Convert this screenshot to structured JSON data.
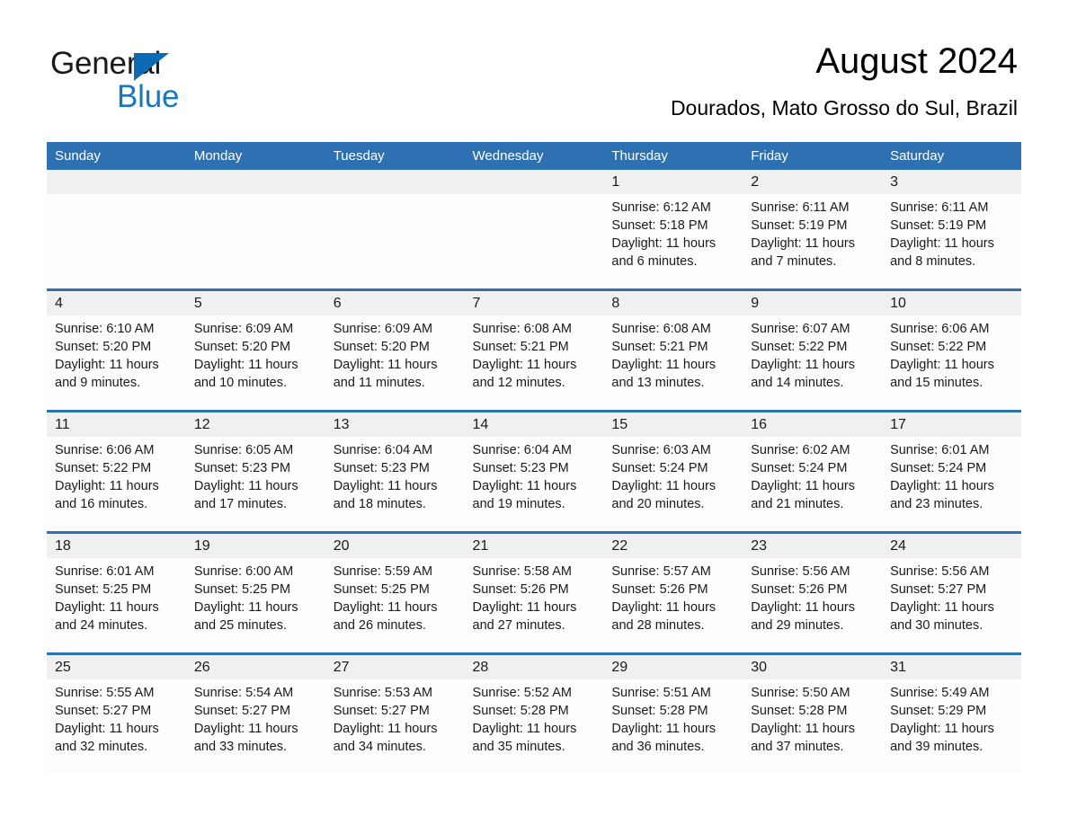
{
  "brand": {
    "name_part1": "General",
    "name_part2": "Blue",
    "triangle_color": "#0a6ab4",
    "blue_color": "#1878be"
  },
  "header": {
    "title": "August 2024",
    "subtitle": "Dourados, Mato Grosso do Sul, Brazil"
  },
  "theme": {
    "header_blue": "#2e71b3",
    "daynum_gray": "#f0f0f0",
    "cell_background": "#fdfdfd"
  },
  "calendar": {
    "weekday_headers": [
      "Sunday",
      "Monday",
      "Tuesday",
      "Wednesday",
      "Thursday",
      "Friday",
      "Saturday"
    ],
    "labels": {
      "sunrise_prefix": "Sunrise:",
      "sunset_prefix": "Sunset:",
      "daylight_prefix": "Daylight:"
    },
    "weeks": [
      [
        {
          "day": "",
          "empty": true
        },
        {
          "day": "",
          "empty": true
        },
        {
          "day": "",
          "empty": true
        },
        {
          "day": "",
          "empty": true
        },
        {
          "day": "1",
          "sunrise": "Sunrise: 6:12 AM",
          "sunset": "Sunset: 5:18 PM",
          "daylight": "Daylight: 11 hours and 6 minutes."
        },
        {
          "day": "2",
          "sunrise": "Sunrise: 6:11 AM",
          "sunset": "Sunset: 5:19 PM",
          "daylight": "Daylight: 11 hours and 7 minutes."
        },
        {
          "day": "3",
          "sunrise": "Sunrise: 6:11 AM",
          "sunset": "Sunset: 5:19 PM",
          "daylight": "Daylight: 11 hours and 8 minutes."
        }
      ],
      [
        {
          "day": "4",
          "sunrise": "Sunrise: 6:10 AM",
          "sunset": "Sunset: 5:20 PM",
          "daylight": "Daylight: 11 hours and 9 minutes."
        },
        {
          "day": "5",
          "sunrise": "Sunrise: 6:09 AM",
          "sunset": "Sunset: 5:20 PM",
          "daylight": "Daylight: 11 hours and 10 minutes."
        },
        {
          "day": "6",
          "sunrise": "Sunrise: 6:09 AM",
          "sunset": "Sunset: 5:20 PM",
          "daylight": "Daylight: 11 hours and 11 minutes."
        },
        {
          "day": "7",
          "sunrise": "Sunrise: 6:08 AM",
          "sunset": "Sunset: 5:21 PM",
          "daylight": "Daylight: 11 hours and 12 minutes."
        },
        {
          "day": "8",
          "sunrise": "Sunrise: 6:08 AM",
          "sunset": "Sunset: 5:21 PM",
          "daylight": "Daylight: 11 hours and 13 minutes."
        },
        {
          "day": "9",
          "sunrise": "Sunrise: 6:07 AM",
          "sunset": "Sunset: 5:22 PM",
          "daylight": "Daylight: 11 hours and 14 minutes."
        },
        {
          "day": "10",
          "sunrise": "Sunrise: 6:06 AM",
          "sunset": "Sunset: 5:22 PM",
          "daylight": "Daylight: 11 hours and 15 minutes."
        }
      ],
      [
        {
          "day": "11",
          "sunrise": "Sunrise: 6:06 AM",
          "sunset": "Sunset: 5:22 PM",
          "daylight": "Daylight: 11 hours and 16 minutes."
        },
        {
          "day": "12",
          "sunrise": "Sunrise: 6:05 AM",
          "sunset": "Sunset: 5:23 PM",
          "daylight": "Daylight: 11 hours and 17 minutes."
        },
        {
          "day": "13",
          "sunrise": "Sunrise: 6:04 AM",
          "sunset": "Sunset: 5:23 PM",
          "daylight": "Daylight: 11 hours and 18 minutes."
        },
        {
          "day": "14",
          "sunrise": "Sunrise: 6:04 AM",
          "sunset": "Sunset: 5:23 PM",
          "daylight": "Daylight: 11 hours and 19 minutes."
        },
        {
          "day": "15",
          "sunrise": "Sunrise: 6:03 AM",
          "sunset": "Sunset: 5:24 PM",
          "daylight": "Daylight: 11 hours and 20 minutes."
        },
        {
          "day": "16",
          "sunrise": "Sunrise: 6:02 AM",
          "sunset": "Sunset: 5:24 PM",
          "daylight": "Daylight: 11 hours and 21 minutes."
        },
        {
          "day": "17",
          "sunrise": "Sunrise: 6:01 AM",
          "sunset": "Sunset: 5:24 PM",
          "daylight": "Daylight: 11 hours and 23 minutes."
        }
      ],
      [
        {
          "day": "18",
          "sunrise": "Sunrise: 6:01 AM",
          "sunset": "Sunset: 5:25 PM",
          "daylight": "Daylight: 11 hours and 24 minutes."
        },
        {
          "day": "19",
          "sunrise": "Sunrise: 6:00 AM",
          "sunset": "Sunset: 5:25 PM",
          "daylight": "Daylight: 11 hours and 25 minutes."
        },
        {
          "day": "20",
          "sunrise": "Sunrise: 5:59 AM",
          "sunset": "Sunset: 5:25 PM",
          "daylight": "Daylight: 11 hours and 26 minutes."
        },
        {
          "day": "21",
          "sunrise": "Sunrise: 5:58 AM",
          "sunset": "Sunset: 5:26 PM",
          "daylight": "Daylight: 11 hours and 27 minutes."
        },
        {
          "day": "22",
          "sunrise": "Sunrise: 5:57 AM",
          "sunset": "Sunset: 5:26 PM",
          "daylight": "Daylight: 11 hours and 28 minutes."
        },
        {
          "day": "23",
          "sunrise": "Sunrise: 5:56 AM",
          "sunset": "Sunset: 5:26 PM",
          "daylight": "Daylight: 11 hours and 29 minutes."
        },
        {
          "day": "24",
          "sunrise": "Sunrise: 5:56 AM",
          "sunset": "Sunset: 5:27 PM",
          "daylight": "Daylight: 11 hours and 30 minutes."
        }
      ],
      [
        {
          "day": "25",
          "sunrise": "Sunrise: 5:55 AM",
          "sunset": "Sunset: 5:27 PM",
          "daylight": "Daylight: 11 hours and 32 minutes."
        },
        {
          "day": "26",
          "sunrise": "Sunrise: 5:54 AM",
          "sunset": "Sunset: 5:27 PM",
          "daylight": "Daylight: 11 hours and 33 minutes."
        },
        {
          "day": "27",
          "sunrise": "Sunrise: 5:53 AM",
          "sunset": "Sunset: 5:27 PM",
          "daylight": "Daylight: 11 hours and 34 minutes."
        },
        {
          "day": "28",
          "sunrise": "Sunrise: 5:52 AM",
          "sunset": "Sunset: 5:28 PM",
          "daylight": "Daylight: 11 hours and 35 minutes."
        },
        {
          "day": "29",
          "sunrise": "Sunrise: 5:51 AM",
          "sunset": "Sunset: 5:28 PM",
          "daylight": "Daylight: 11 hours and 36 minutes."
        },
        {
          "day": "30",
          "sunrise": "Sunrise: 5:50 AM",
          "sunset": "Sunset: 5:28 PM",
          "daylight": "Daylight: 11 hours and 37 minutes."
        },
        {
          "day": "31",
          "sunrise": "Sunrise: 5:49 AM",
          "sunset": "Sunset: 5:29 PM",
          "daylight": "Daylight: 11 hours and 39 minutes."
        }
      ]
    ]
  }
}
